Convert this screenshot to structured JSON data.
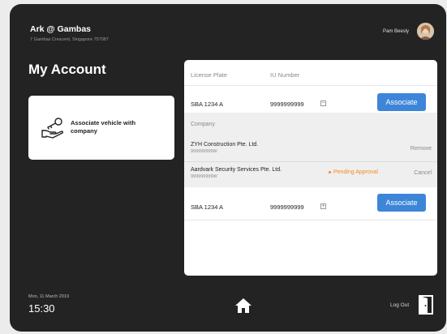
{
  "header": {
    "title": "Ark @ Gambas",
    "address": "7 Gambas Crescent, Singapore 757087",
    "user_name": "Pam Beesly"
  },
  "page": {
    "title": "My Account"
  },
  "associate_card": {
    "icon": "car-key-in-hand-icon",
    "label": "Associate vehicle with company"
  },
  "table": {
    "columns": [
      "License Plate",
      "IU Number"
    ],
    "rows": [
      {
        "plate": "SBA 1234 A",
        "iu": "9999999999",
        "toggle": "−",
        "button": "Associate"
      },
      {
        "plate": "SBA 1234 A",
        "iu": "9999999999",
        "toggle": "+",
        "button": "Associate"
      }
    ],
    "expanded": {
      "label": "Company",
      "companies": [
        {
          "name": "ZYH Construction Pte. Ltd.",
          "id": "999999999W",
          "action": "Remove"
        },
        {
          "name": "Aardvark Security Services Pte. Ltd.",
          "id": "999999999W",
          "status": "Pending Approval",
          "action": "Cancel"
        }
      ]
    }
  },
  "footer": {
    "date": "Mon, 11 March 2019",
    "time": "15:30",
    "logout_label": "Log Out",
    "home_icon": "home-icon",
    "logout_icon": "door-exit-icon"
  },
  "colors": {
    "background": "#232323",
    "primary_button": "#3d85d8",
    "pending": "#f08c1e"
  }
}
